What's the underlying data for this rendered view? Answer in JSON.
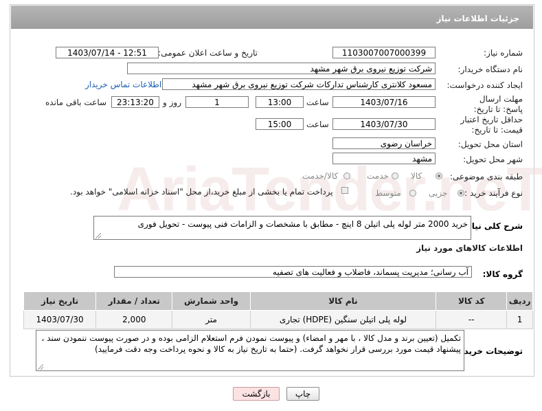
{
  "header": {
    "title": "جزئیات اطلاعات نیاز"
  },
  "fields": {
    "need_number_label": "شماره نیاز:",
    "need_number": "1103007007000399",
    "announce_label": "تاریخ و ساعت اعلان عمومی:",
    "announce_value": "1403/07/14 - 12:51",
    "buyer_org_label": "نام دستگاه خریدار:",
    "buyer_org": "شرکت توزیع نیروی برق شهر مشهد",
    "requester_label": "ایجاد کننده درخواست:",
    "requester": "مسعود کلانتری کارشناس تدارکات شرکت توزیع نیروی برق شهر مشهد",
    "contact_link": "اطلاعات تماس خریدار",
    "deadline_label": "مهلت ارسال پاسخ: تا تاریخ:",
    "deadline_date": "1403/07/16",
    "time_label": "ساعت",
    "deadline_time": "13:00",
    "days_value": "1",
    "days_label": "روز و",
    "remaining_time": "23:13:20",
    "remaining_label": "ساعت باقی مانده",
    "validity_label": "حداقل تاریخ اعتبار قیمت: تا تاریخ:",
    "validity_date": "1403/07/30",
    "validity_time": "15:00",
    "province_label": "استان محل تحویل:",
    "province": "خراسان رضوی",
    "city_label": "شهر محل تحویل:",
    "city": "مشهد",
    "category_label": "طبقه بندی موضوعی:",
    "category_options": [
      "کالا",
      "خدمت",
      "کالا/خدمت"
    ],
    "process_label": "نوع فرآیند خرید :",
    "process_options": [
      "جزیی",
      "متوسط"
    ],
    "payment_note": "پرداخت تمام یا بخشی از مبلغ خرید،از محل \"اسناد خزانه اسلامی\" خواهد بود."
  },
  "description": {
    "label": "شرح کلی نیاز:",
    "text": "خرید 2000 متر لوله پلی اتیلن 8 اینچ - مطابق با مشخصات و الزامات فنی پیوست - تحویل فوری"
  },
  "goods": {
    "section_title": "اطلاعات کالاهای مورد نیاز",
    "group_label": "گروه کالا:",
    "group_value": "آب رسانی؛ مدیریت پسماند، فاضلاب و فعالیت های تصفیه",
    "columns": [
      "ردیف",
      "کد کالا",
      "نام کالا",
      "واحد شمارش",
      "تعداد / مقدار",
      "تاریخ نیاز"
    ],
    "rows": [
      {
        "row": "1",
        "code": "--",
        "name": "لوله پلی اتیلن سنگین (HDPE) تجاری",
        "unit": "متر",
        "qty": "2,000",
        "date": "1403/07/30"
      }
    ]
  },
  "buyer_notes": {
    "label": "توضیحات خریدار:",
    "text": "تکمیل (تعیین برند و مدل کالا ، با مهر و امضاء) و پیوست نمودن فرم استعلام الزامی بوده و در صورت پیوست ننمودن سند ، پیشنهاد قیمت مورد بررسی قرار نخواهد گرفت. (حتما به تاریخ نیاز به کالا و نحوه پرداخت وجه دقت فرمایید)"
  },
  "buttons": {
    "print": "چاپ",
    "back": "بازگشت"
  },
  "watermark": "AriaTender.neT"
}
